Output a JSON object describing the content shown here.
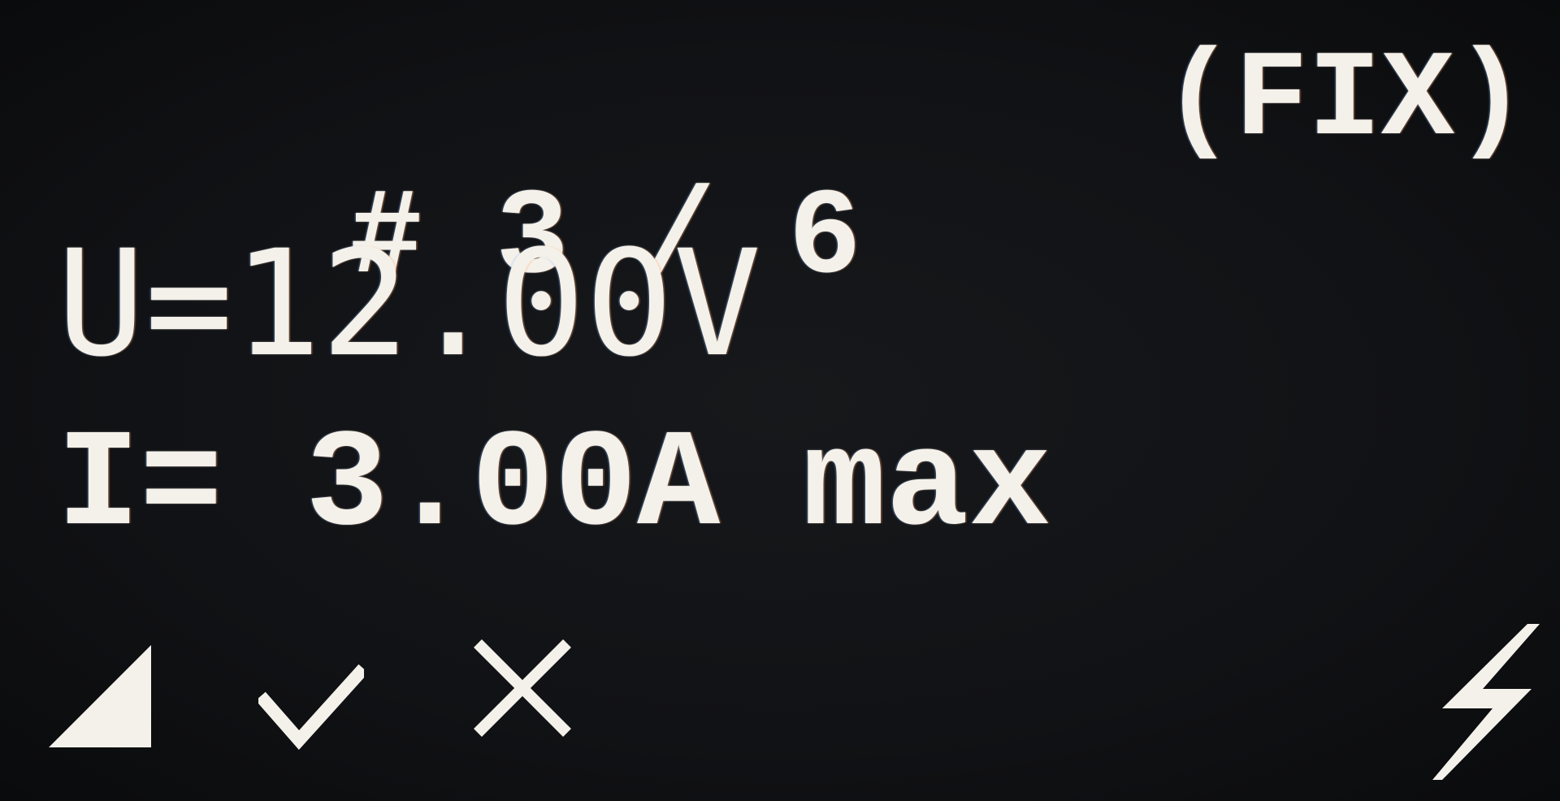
{
  "header": {
    "preset_label": "# 3 / 6",
    "mode_label": "(FIX)"
  },
  "readings": {
    "voltage": "U=12.00V",
    "current": "I= 3.00A max"
  },
  "icons": {
    "signal": "signal-triangle-icon",
    "confirm": "check-icon",
    "cancel": "cross-icon",
    "output": "lightning-icon"
  },
  "colors": {
    "background": "#111215",
    "text": "#f4f1ea"
  }
}
